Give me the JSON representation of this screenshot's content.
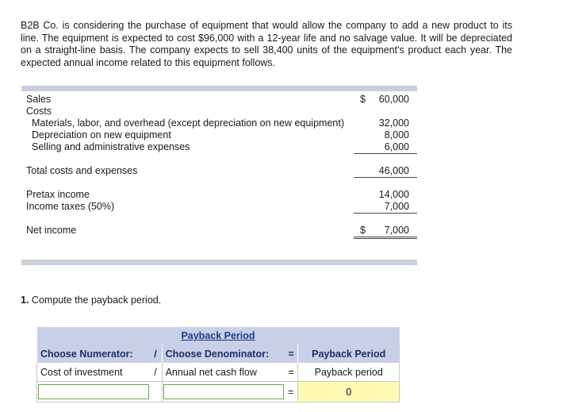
{
  "intro": "B2B Co. is considering the purchase of equipment that would allow the company to add a new product to its line. The equipment is expected to cost $96,000 with a 12-year life and no salvage value. It will be depreciated on a straight-line basis. The company expects to sell 38,400 units of the equipment's product each year. The expected annual income related to this equipment follows.",
  "statement": {
    "sales_label": "Sales",
    "sales_dollar": "$",
    "sales_value": "60,000",
    "costs_label": "Costs",
    "materials_label": "Materials, labor, and overhead (except depreciation on new equipment)",
    "materials_value": "32,000",
    "depreciation_label": "Depreciation on new equipment",
    "depreciation_value": "8,000",
    "selling_label": "Selling and administrative expenses",
    "selling_value": "6,000",
    "total_label": "Total costs and expenses",
    "total_value": "46,000",
    "pretax_label": "Pretax income",
    "pretax_value": "14,000",
    "taxes_label": "Income taxes (50%)",
    "taxes_value": "7,000",
    "net_label": "Net income",
    "net_dollar": "$",
    "net_value": "7,000"
  },
  "question": {
    "number": "1.",
    "text": "Compute the payback period."
  },
  "payback": {
    "title": "Payback Period",
    "head_numerator": "Choose Numerator:",
    "head_div": "/",
    "head_denominator": "Choose Denominator:",
    "head_eq": "=",
    "head_result": "Payback Period",
    "row_numerator": "Cost of investment",
    "row_div": "/",
    "row_denominator": "Annual net cash flow",
    "row_eq": "=",
    "row_result": "Payback period",
    "input_eq": "=",
    "input_result": "0"
  }
}
